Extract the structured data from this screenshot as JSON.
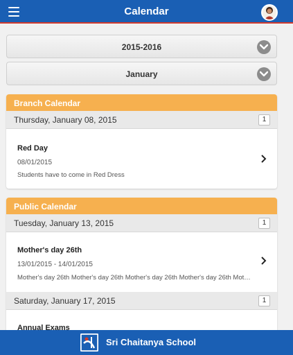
{
  "appbar": {
    "title": "Calendar"
  },
  "selectors": {
    "year": "2015-2016",
    "month": "January"
  },
  "branch": {
    "header": "Branch Calendar",
    "date": "Thursday, January 08, 2015",
    "count": "1",
    "event": {
      "title": "Red Day",
      "date": "08/01/2015",
      "desc": "Students have to come in Red Dress"
    }
  },
  "public": {
    "header": "Public Calendar",
    "groups": [
      {
        "date": "Tuesday, January 13, 2015",
        "count": "1",
        "event": {
          "title": "Mother's day 26th",
          "date": "13/01/2015 - 14/01/2015",
          "desc": "Mother's day 26th Mother's day 26th Mother's day 26th Mother's day 26th Mother's day 26th"
        }
      },
      {
        "date": "Saturday, January 17, 2015",
        "count": "1",
        "event": {
          "title": "Annual Exams"
        }
      }
    ]
  },
  "footer": {
    "brand": "Sri Chaitanya School"
  },
  "colors": {
    "appbar": "#1a5fb4",
    "accent_line": "#d23b2e",
    "section_header": "#f6b04f"
  }
}
